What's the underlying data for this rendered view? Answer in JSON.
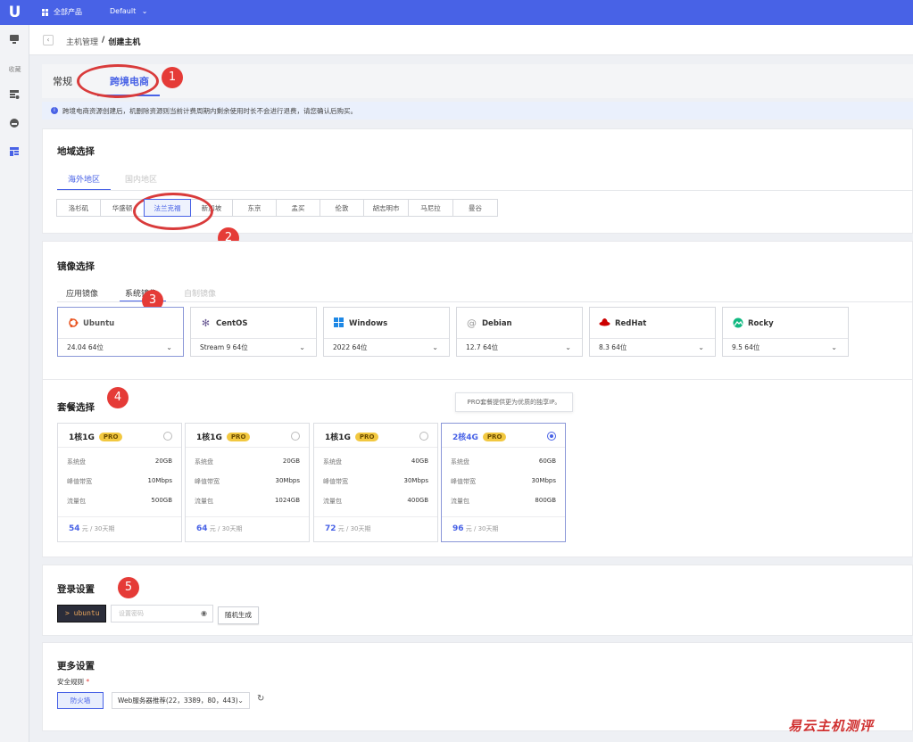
{
  "topbar": {
    "logo": "U",
    "all_products": "全部产品",
    "project": "Default",
    "project_chevron": "⌄"
  },
  "sidebar": {
    "items": [
      {
        "icon": "monitor-icon"
      },
      {
        "label": "收藏"
      },
      {
        "icon": "server-list-icon"
      },
      {
        "icon": "cloud-icon"
      },
      {
        "icon": "host-icon"
      }
    ]
  },
  "breadcrumb": {
    "back": "‹",
    "parent": "主机管理",
    "separator": "/",
    "current": "创建主机"
  },
  "tabs": [
    {
      "label": "常规"
    },
    {
      "label": "跨境电商",
      "active": true
    }
  ],
  "notice": "跨境电商资源创建后，机删除资源则当前计费周期内剩余使用时长不会进行退费，请您确认后购买。",
  "annotations": [
    "1",
    "2",
    "3",
    "4",
    "5"
  ],
  "region": {
    "title": "地域选择",
    "tabs": [
      "海外地区",
      "国内地区"
    ],
    "options": [
      "洛杉矶",
      "华盛顿",
      "法兰克福",
      "新加坡",
      "东京",
      "孟买",
      "伦敦",
      "胡志明市",
      "马尼拉",
      "曼谷"
    ],
    "selected": "法兰克福"
  },
  "image": {
    "title": "镜像选择",
    "tabs": [
      "应用镜像",
      "系统镜像",
      "自制镜像"
    ],
    "options": [
      {
        "name": "Ubuntu",
        "version": "24.04 64位",
        "icon": "ubuntu-icon",
        "color": "#e95420"
      },
      {
        "name": "CentOS",
        "version": "Stream 9 64位",
        "icon": "centos-icon",
        "color": "#6b5b95"
      },
      {
        "name": "Windows",
        "version": "2022 64位",
        "icon": "windows-icon",
        "color": "#1e88e5"
      },
      {
        "name": "Debian",
        "version": "12.7 64位",
        "icon": "debian-icon",
        "color": "#9e9e9e"
      },
      {
        "name": "RedHat",
        "version": "8.3 64位",
        "icon": "redhat-icon",
        "color": "#cc0000"
      },
      {
        "name": "Rocky",
        "version": "9.5 64位",
        "icon": "rocky-icon",
        "color": "#10b981"
      }
    ],
    "selected": "Ubuntu"
  },
  "package": {
    "title": "套餐选择",
    "tooltip": "PRO套餐提供更为优质的独享IP。",
    "pro_label": "PRO",
    "spec_labels": [
      "系统盘",
      "峰值带宽",
      "流量包"
    ],
    "price_unit": "元 / 30天期",
    "options": [
      {
        "name": "1核1G",
        "disk": "20GB",
        "bandwidth": "10Mbps",
        "traffic": "500GB",
        "price": "54"
      },
      {
        "name": "1核1G",
        "disk": "20GB",
        "bandwidth": "30Mbps",
        "traffic": "1024GB",
        "price": "64"
      },
      {
        "name": "1核1G",
        "disk": "40GB",
        "bandwidth": "30Mbps",
        "traffic": "400GB",
        "price": "72"
      },
      {
        "name": "2核4G",
        "disk": "60GB",
        "bandwidth": "30Mbps",
        "traffic": "800GB",
        "price": "96",
        "selected": true
      }
    ]
  },
  "login": {
    "title": "登录设置",
    "username": "> ubuntu",
    "password_placeholder": "设置密码",
    "generate": "随机生成"
  },
  "more": {
    "title": "更多设置",
    "security_label": "安全规则",
    "required_mark": "*",
    "firewall": "防火墙",
    "rule": "Web服务器推荐(22，3389，80，443)",
    "refresh_icon": "refresh-icon"
  },
  "watermark": "易云主机测评",
  "colors": {
    "accent": "#4862e6",
    "annotation_red": "#e53b37",
    "pro_yellow": "#f2c840"
  }
}
